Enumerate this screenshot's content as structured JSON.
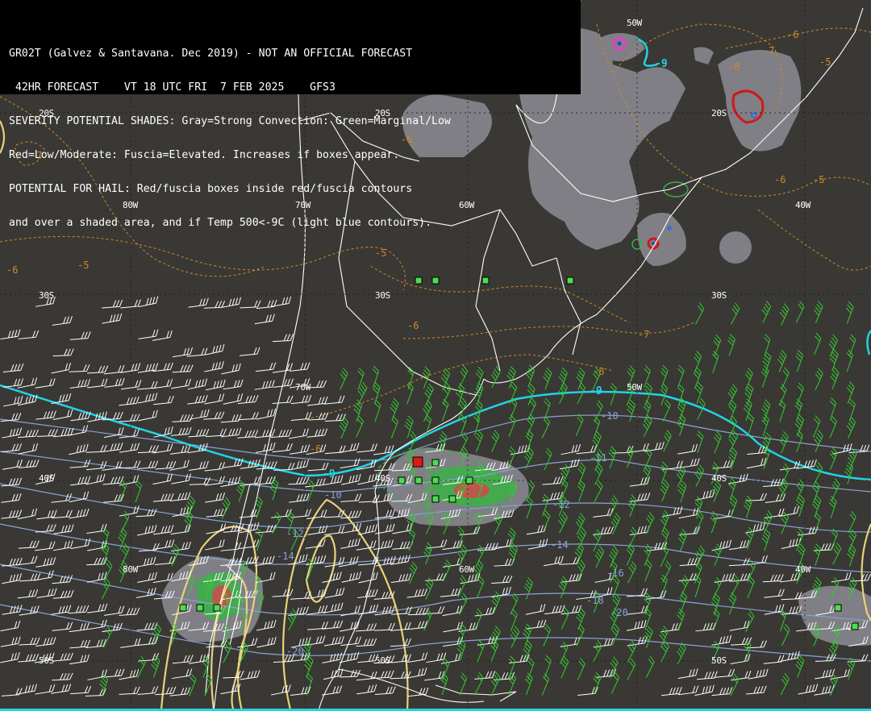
{
  "header": {
    "line1": "GR02T (Galvez & Santavana. Dec 2019) - NOT AN OFFICIAL FORECAST",
    "line2": " 42HR FORECAST    VT 18 UTC FRI  7 FEB 2025    GFS3",
    "line3": "SEVERITY POTENTIAL SHADES: Gray=Strong Convection: Green=Marginal/Low",
    "line4": "Red=Low/Moderate: Fuscia=Elevated. Increases if boxes appear.",
    "line5": "POTENTIAL FOR HAIL: Red/fuscia boxes inside red/fuscia contours",
    "line6": "and over a shaded area, and if Temp 500<-9C (light blue contours)."
  },
  "grid_labels": {
    "lat_20s_a": "20S",
    "lat_20s_b": "20S",
    "lat_20s_c": "20S",
    "lat_30s_a": "30S",
    "lat_30s_b": "30S",
    "lat_30s_c": "30S",
    "lat_40s_a": "40S",
    "lat_40s_b": "40S",
    "lat_40s_c": "40S",
    "lat_50s_a": "50S",
    "lat_50s_b": "50S",
    "lat_50s_c": "50S",
    "lon_80w_a": "80W",
    "lon_80w_b": "80W",
    "lon_70w_a": "70W",
    "lon_70w_b": "70W",
    "lon_60w_a": "60W",
    "lon_60w_b": "60W",
    "lon_50w_a": "50W",
    "lon_50w_b": "50W",
    "lon_40w_a": "40W",
    "lon_40w_b": "40W"
  },
  "contour_labels": {
    "o_m7_a": "-7",
    "o_m6_a": "-6",
    "o_m5_a": "-5",
    "o_m6_b": "-6",
    "o_m5_b": "-5",
    "o_m6_c": "-6",
    "o_m7_b": "-7",
    "o_m8_a": "-8",
    "o_m6_d": "-6",
    "o_m5_c": "-5",
    "o_m6_e": "-6",
    "o_m5_d": "-5",
    "o_m8_b": "-8",
    "o_m7_c": "-7",
    "o_m6_f": "-6",
    "c_m9_a": "-9",
    "c_m9_b": "-9",
    "c_m9_c": "-9",
    "b_m10_a": "-10",
    "b_m10_b": "-10",
    "b_m11": "-11",
    "b_m12_a": "-12",
    "b_m12_b": "-12",
    "b_m14_a": "-14",
    "b_m14_b": "-14",
    "b_m16": "-16",
    "b_m18": "-18",
    "b_m20_a": "-20",
    "b_m20_b": "-20"
  },
  "colors": {
    "background": "#3a3834",
    "land_outline": "#ffffff",
    "strong_convection": "#8c8c94",
    "marginal": "#3fae4a",
    "low_moderate": "#d04a4a",
    "temp_minus9": "#22d3e6",
    "temp_500": "#8aa3d8",
    "thickness": "#d08a2a",
    "yellow_contour": "#e8d27a",
    "wind_barb_white": "#ffffff",
    "wind_barb_green": "#33cc33"
  }
}
